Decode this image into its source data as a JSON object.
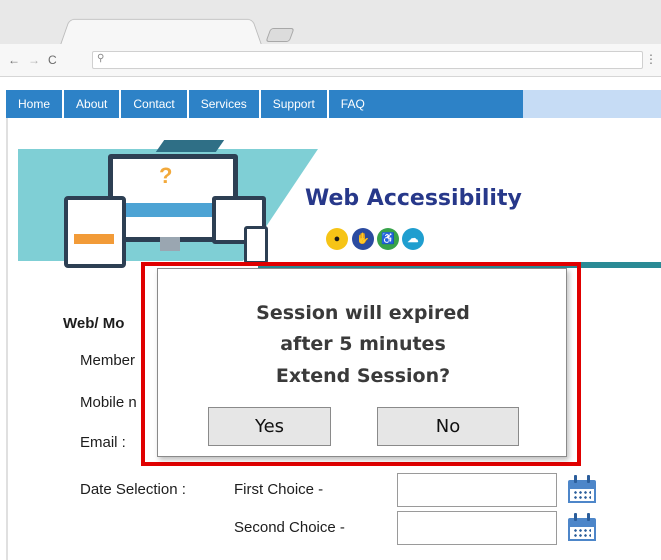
{
  "browser": {
    "back_glyph": "←",
    "forward_glyph": "→",
    "reload_glyph": "C",
    "search_glyph": "⚲",
    "menu_glyph": "⋮"
  },
  "nav": {
    "items": [
      {
        "label": "Home"
      },
      {
        "label": "About"
      },
      {
        "label": "Contact"
      },
      {
        "label": "Services"
      },
      {
        "label": "Support"
      },
      {
        "label": "FAQ"
      }
    ]
  },
  "banner": {
    "title": "Web Accessibility",
    "icons": [
      "eye-icon",
      "sign-language-icon",
      "wheelchair-icon",
      "brain-icon"
    ]
  },
  "form": {
    "heading": "Web/ Mo",
    "member_label": "Member",
    "mobile_label": "Mobile n",
    "email_label": "Email :",
    "date_selection_label": "Date Selection :",
    "first_choice_label": "First Choice -",
    "second_choice_label": "Second Choice -",
    "first_choice_value": "",
    "second_choice_value": ""
  },
  "dialog": {
    "line1": "Session will expired",
    "line2": "after 5 minutes",
    "line3": "Extend Session?",
    "yes_label": "Yes",
    "no_label": "No"
  },
  "colors": {
    "nav_bg": "#2d82c7",
    "title_color": "#27388a",
    "highlight_border": "#e00000",
    "teal_band": "#7fcfd5"
  }
}
